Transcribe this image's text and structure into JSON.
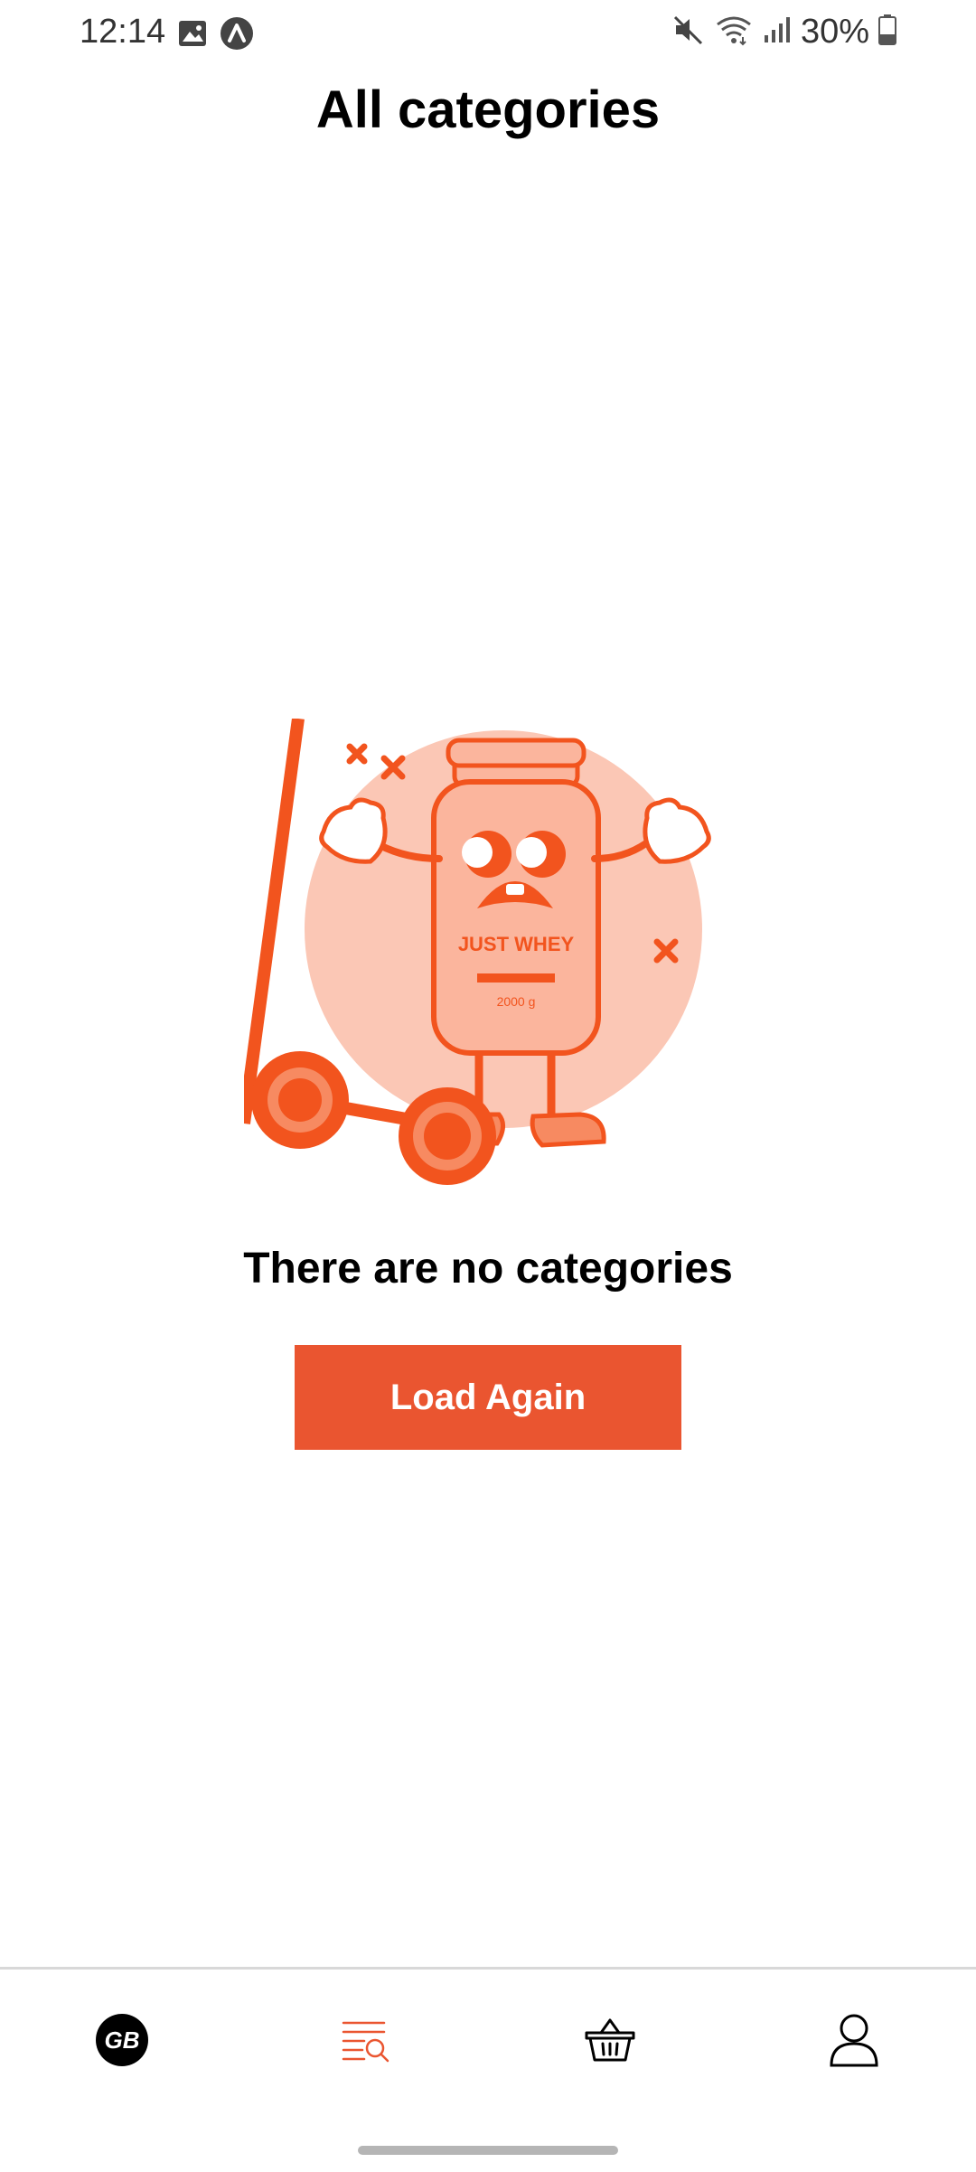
{
  "status_bar": {
    "time": "12:14",
    "battery": "30%",
    "icons": [
      "image-icon",
      "app-notification-icon",
      "mute-icon",
      "wifi-icon",
      "signal-icon",
      "battery-icon"
    ]
  },
  "header": {
    "title": "All categories"
  },
  "empty_state": {
    "illustration_label": "JUST WHEY",
    "illustration_weight": "2000 g",
    "message": "There are no categories",
    "button_label": "Load Again"
  },
  "bottom_nav": {
    "items": [
      {
        "name": "home",
        "icon": "gb-logo-icon",
        "logo_text": "GB",
        "active": false
      },
      {
        "name": "categories",
        "icon": "catalog-search-icon",
        "active": true
      },
      {
        "name": "cart",
        "icon": "basket-icon",
        "active": false
      },
      {
        "name": "profile",
        "icon": "user-icon",
        "active": false
      }
    ]
  },
  "colors": {
    "accent": "#ea5530",
    "illustration_bg": "#fbc7b5",
    "text": "#000000",
    "inactive_icon": "#000000"
  }
}
